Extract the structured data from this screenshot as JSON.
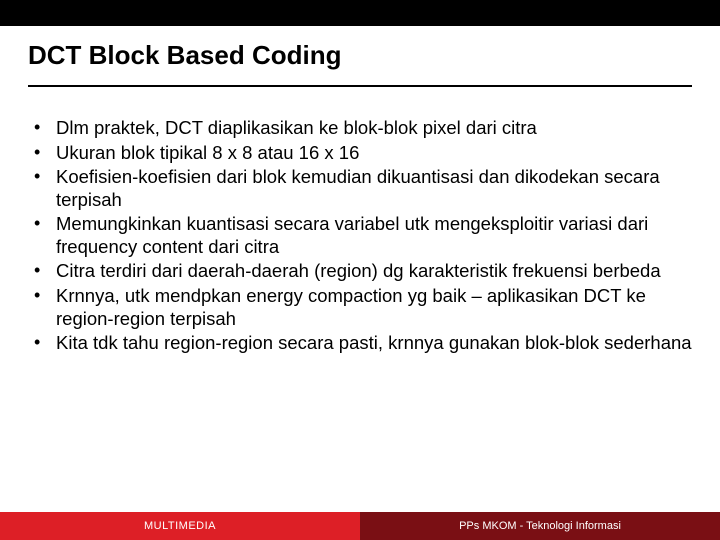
{
  "header": {
    "title": "DCT Block Based Coding"
  },
  "bullets": [
    "Dlm praktek, DCT diaplikasikan ke blok-blok pixel dari citra",
    "Ukuran blok tipikal 8 x 8 atau 16 x 16",
    "Koefisien-koefisien dari blok kemudian dikuantisasi dan dikodekan secara terpisah",
    "Memungkinkan kuantisasi secara variabel utk mengeksploitir variasi dari frequency content dari citra",
    "Citra terdiri dari daerah-daerah (region) dg karakteristik frekuensi berbeda",
    "Krnnya, utk mendpkan energy compaction yg baik – aplikasikan DCT ke region-region terpisah",
    "Kita tdk tahu region-region secara pasti, krnnya gunakan blok-blok sederhana"
  ],
  "footer": {
    "left": "MULTIMEDIA",
    "right": "PPs MKOM - Teknologi Informasi"
  }
}
